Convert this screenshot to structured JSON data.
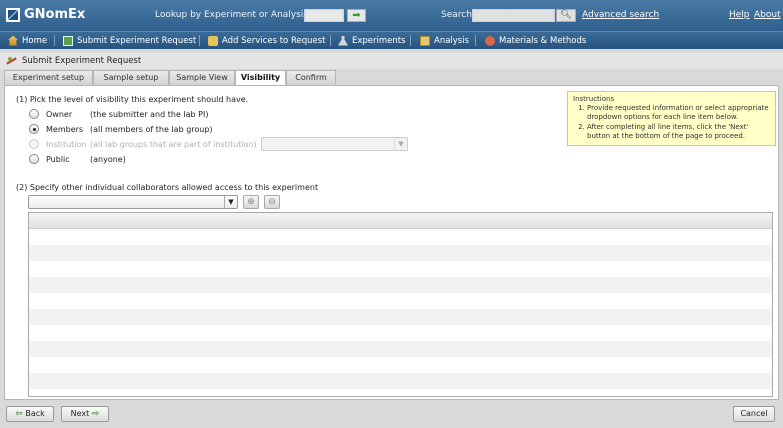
{
  "header": {
    "app_name": "GNomEx",
    "lookup_label": "Lookup by Experiment or Analysis #",
    "lookup_value": "",
    "go_icon": "arrow-right-icon",
    "search_label": "Search",
    "search_value": "",
    "search_icon": "magnifier-icon",
    "advanced_search": "Advanced search",
    "help": "Help",
    "about": "About"
  },
  "nav": {
    "items": [
      {
        "label": "Home",
        "icon": "home-icon"
      },
      {
        "label": "Submit Experiment Request",
        "icon": "submit-icon"
      },
      {
        "label": "Add Services to Request",
        "icon": "services-icon"
      },
      {
        "label": "Experiments",
        "icon": "flask-icon"
      },
      {
        "label": "Analysis",
        "icon": "analysis-icon"
      },
      {
        "label": "Materials & Methods",
        "icon": "materials-icon"
      }
    ]
  },
  "panel": {
    "title": "Submit Experiment Request"
  },
  "tabs": [
    {
      "label": "Experiment setup"
    },
    {
      "label": "Sample setup"
    },
    {
      "label": "Sample View"
    },
    {
      "label": "Visibility",
      "active": true
    },
    {
      "label": "Confirm"
    }
  ],
  "visibility": {
    "question1": "(1) Pick the level of visibility this experiment should have.",
    "options": [
      {
        "name": "Owner",
        "desc": "(the submitter and the lab PI)",
        "checked": false,
        "disabled": false
      },
      {
        "name": "Members",
        "desc": "(all members of the lab group)",
        "checked": true,
        "disabled": false
      },
      {
        "name": "Institution",
        "desc": "(all lab groups that are part of institution)",
        "checked": false,
        "disabled": true
      },
      {
        "name": "Public",
        "desc": "(anyone)",
        "checked": false,
        "disabled": false
      }
    ],
    "institution_select": "",
    "question2": "(2) Specify other individual collaborators allowed access to this experiment",
    "collaborator_select": ""
  },
  "instructions": {
    "title": "Instructions",
    "items": [
      "Provide requested information or select appropriate dropdown options for each line item below.",
      "After completing all line items, click the 'Next' button at the bottom of the page to proceed."
    ]
  },
  "footer": {
    "back": "Back",
    "next": "Next",
    "cancel": "Cancel"
  },
  "colors": {
    "header_bg": "#3b6b97",
    "instructions_bg": "#ffffc8",
    "accent_green": "#3a9a2a"
  }
}
